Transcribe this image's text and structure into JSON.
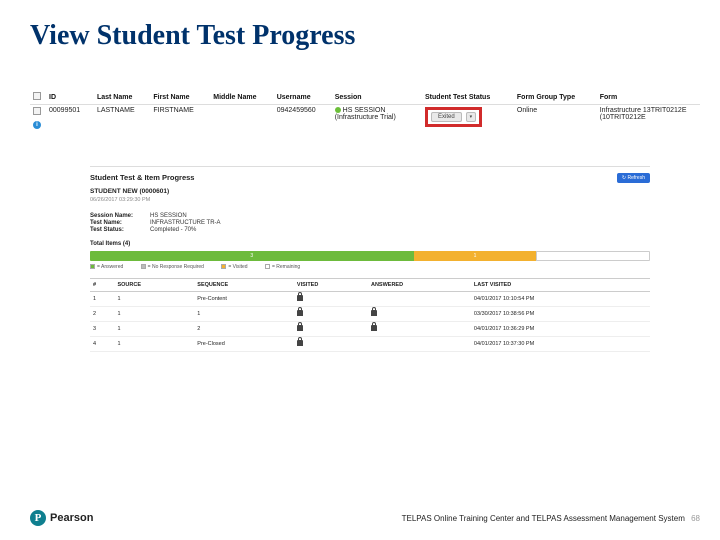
{
  "title": "View Student Test Progress",
  "grid": {
    "headers": [
      "",
      "ID",
      "Last Name",
      "First Name",
      "Middle Name",
      "Username",
      "Session",
      "Student Test Status",
      "Form Group Type",
      "Form"
    ],
    "row": {
      "id": "00099501",
      "last_name": "LASTNAME",
      "first_name": "FIRSTNAME",
      "middle_name": "",
      "username": "0942459560",
      "session": "HS SESSION (Infrastructure Trial)",
      "status": "Exited",
      "form_group_type": "Online",
      "form": "Infrastructure 13TRIT0212E (10TRIT0212E"
    }
  },
  "detail": {
    "panel_title": "Student Test & Item Progress",
    "student_label": "STUDENT NEW (0000601)",
    "timestamp": "06/26/2017 03:29:30 PM",
    "refresh_label": "Refresh",
    "fields": {
      "session_name_k": "Session Name:",
      "session_name_v": "HS SESSION",
      "test_name_k": "Test Name:",
      "test_name_v": "INFRASTRUCTURE TR-A",
      "test_status_k": "Test Status:",
      "test_status_v": "Completed - 70%"
    },
    "items_heading": "Total Items (4)",
    "progress": {
      "green_pct": 58,
      "orange_pct": 22,
      "white_pct": 20,
      "green_n": "3",
      "orange_n": "1"
    },
    "legend": {
      "answered": "= Answered",
      "no_response": "= No Response Required",
      "visited": "= Visited",
      "remaining": "= Remaining"
    },
    "item_headers": [
      "#",
      "SOURCE",
      "SEQUENCE",
      "VISITED",
      "ANSWERED",
      "LAST VISITED"
    ],
    "items": [
      {
        "n": "1",
        "src": "1",
        "seq": "Pre-Content",
        "visited": true,
        "answered": "",
        "last": "04/01/2017 10:10:54 PM"
      },
      {
        "n": "2",
        "src": "1",
        "seq": "1",
        "visited": true,
        "answered": "locked",
        "last": "03/30/2017 10:38:56 PM"
      },
      {
        "n": "3",
        "src": "1",
        "seq": "2",
        "visited": true,
        "answered": "locked",
        "last": "04/01/2017 10:36:29 PM"
      },
      {
        "n": "4",
        "src": "1",
        "seq": "Pre-Closed",
        "visited": true,
        "answered": "",
        "last": "04/01/2017 10:37:30 PM"
      }
    ]
  },
  "footer": {
    "brand": "Pearson",
    "caption": "TELPAS Online Training Center and TELPAS Assessment Management System",
    "page": "68"
  }
}
